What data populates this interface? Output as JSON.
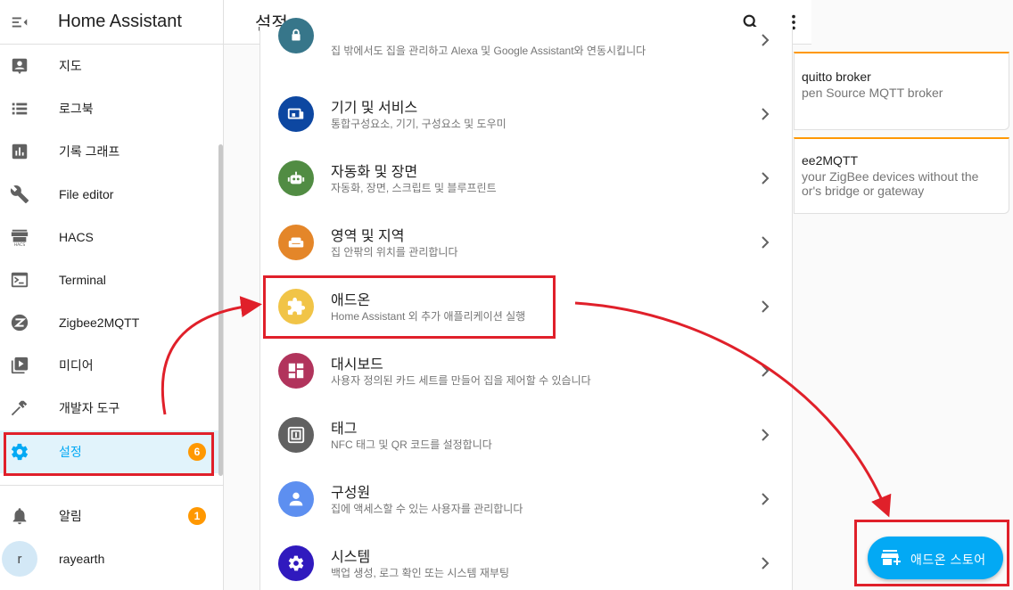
{
  "app": {
    "title": "Home Assistant"
  },
  "sidebar": {
    "items": [
      {
        "label": "지도",
        "icon": "map-account-icon"
      },
      {
        "label": "로그북",
        "icon": "format-list-icon"
      },
      {
        "label": "기록 그래프",
        "icon": "chart-box-icon"
      },
      {
        "label": "File editor",
        "icon": "wrench-icon"
      },
      {
        "label": "HACS",
        "icon": "hacs-store-icon"
      },
      {
        "label": "Terminal",
        "icon": "console-icon"
      },
      {
        "label": "Zigbee2MQTT",
        "icon": "zigbee-icon"
      },
      {
        "label": "미디어",
        "icon": "play-box-icon"
      },
      {
        "label": "개발자 도구",
        "icon": "hammer-icon"
      },
      {
        "label": "설정",
        "icon": "cog-icon",
        "badge": "6"
      }
    ],
    "notifications": {
      "label": "알림",
      "badge": "1"
    },
    "user": {
      "name": "rayearth",
      "initial": "r"
    }
  },
  "header": {
    "title": "설정"
  },
  "settings": [
    {
      "title": "",
      "subtitle": "집 밖에서도 집을 관리하고 Alexa 및 Google Assistant와 연동시킵니다",
      "color": "#37768a",
      "icon": "cloud-lock-icon"
    },
    {
      "title": "기기 및 서비스",
      "subtitle": "통합구성요소, 기기, 구성요소 및 도우미",
      "color": "#0d47a1",
      "icon": "devices-icon"
    },
    {
      "title": "자동화 및 장면",
      "subtitle": "자동화, 장면, 스크립트 및 블루프린트",
      "color": "#518c43",
      "icon": "robot-icon"
    },
    {
      "title": "영역 및 지역",
      "subtitle": "집 안팎의 위치를 관리합니다",
      "color": "#e48629",
      "icon": "sofa-icon"
    },
    {
      "title": "애드온",
      "subtitle": "Home Assistant 외 추가 애플리케이션 실행",
      "color": "#f1c447",
      "icon": "puzzle-icon"
    },
    {
      "title": "대시보드",
      "subtitle": "사용자 정의된 카드 세트를 만들어 집을 제어할 수 있습니다",
      "color": "#b1345c",
      "icon": "view-dashboard-icon"
    },
    {
      "title": "태그",
      "subtitle": "NFC 태그 및 QR 코드를 설정합니다",
      "color": "#616161",
      "icon": "nfc-icon"
    },
    {
      "title": "구성원",
      "subtitle": "집에 액세스할 수 있는 사용자를 관리합니다",
      "color": "#5d8ff0",
      "icon": "account-icon"
    },
    {
      "title": "시스템",
      "subtitle": "백업 생성, 로그 확인 또는 시스템 재부팅",
      "color": "#301abe",
      "icon": "cog-icon"
    }
  ],
  "addons": [
    {
      "title": "quitto broker",
      "description": "pen Source MQTT broker"
    },
    {
      "title": "ee2MQTT",
      "description": "your ZigBee devices without the",
      "description2": "or's bridge or gateway"
    }
  ],
  "fab": {
    "label": "애드온 스토어",
    "icon": "store-plus-icon"
  },
  "colors": {
    "accent": "#03a9f4",
    "badge": "#ff9800",
    "annotation": "#e0202a"
  }
}
